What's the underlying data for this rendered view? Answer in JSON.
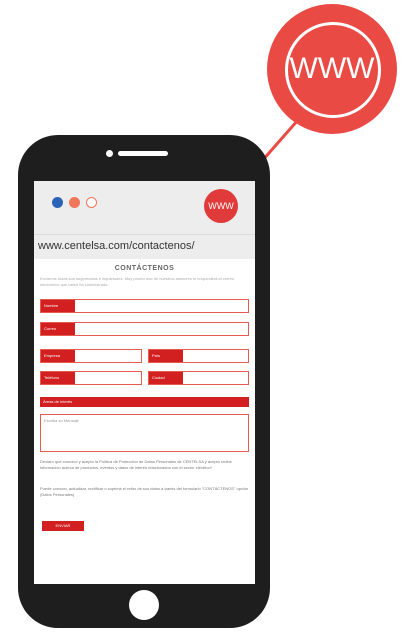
{
  "callout": {
    "label": "WWW"
  },
  "browser": {
    "badge": "WWW",
    "url": "www.centelsa.com/contactenos/"
  },
  "page": {
    "title": "CONTÁCTENOS",
    "intro": "Envíenos todas sus sugerencias e inquietudes. Muy pronto uno de nuestros asesores le responderá al correo electrónico que usted ha suministrado.",
    "fields": {
      "nombre": "Nombre",
      "correo": "Correo",
      "empresa": "Empresa",
      "pais": "País",
      "telefono": "Teléfono",
      "ciudad": "Ciudad"
    },
    "area": "Áreas de interés",
    "message_placeholder": "Escriba su Mensaje",
    "policy": "Declaro que conozco y acepto la Política de Protección de Datos Personales de CENTELSA y acepto recibir información acerca de productos, eventos y datos de interés relacionados con el sector eléctrico*",
    "policy2": "Puede conocer, actualizar, rectificar o suprimir el retiro de sus datos a través del formulario \"CONTÁCTENOS\" opción (Datos Personales)",
    "submit": "ENVIAR"
  }
}
